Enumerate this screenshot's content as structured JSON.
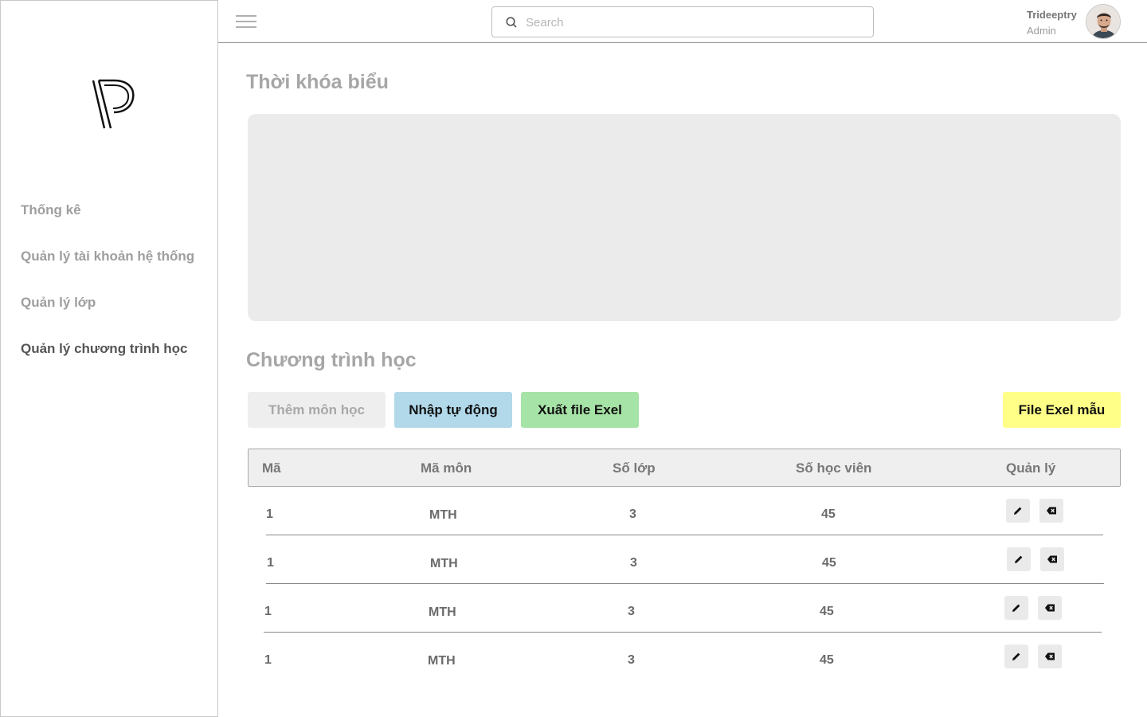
{
  "sidebar": {
    "logo_icon": "p-logo-icon",
    "items": [
      {
        "label": "Thống kê",
        "active": false
      },
      {
        "label": "Quản lý tài khoản hệ thống",
        "active": false
      },
      {
        "label": "Quản lý lớp",
        "active": false
      },
      {
        "label": "Quản lý chương trình học",
        "active": true
      }
    ]
  },
  "header": {
    "menu_icon": "hamburger-icon",
    "search": {
      "placeholder": "Search",
      "value": "",
      "icon": "search-icon"
    },
    "user": {
      "name": "Trideeptry",
      "role": "Admin",
      "avatar_icon": "avatar"
    }
  },
  "timetable": {
    "title": "Thời khóa biểu"
  },
  "program": {
    "title": "Chương trình học",
    "buttons": {
      "add": "Thêm môn học",
      "import": "Nhập tự động",
      "export": "Xuất file Exel",
      "template": "File Exel mẫu"
    },
    "colors": {
      "import": "#b1d9e9",
      "export": "#a6e3a6",
      "template": "#ffff88",
      "add": "#eeeeee"
    },
    "columns": [
      "Mã",
      "Mã môn",
      "Số lớp",
      "Số học viên",
      "Quản lý"
    ],
    "rows": [
      {
        "id": "1",
        "code": "MTH",
        "classes": "3",
        "students": "45"
      },
      {
        "id": "1",
        "code": "MTH",
        "classes": "3",
        "students": "45"
      },
      {
        "id": "1",
        "code": "MTH",
        "classes": "3",
        "students": "45"
      },
      {
        "id": "1",
        "code": "MTH",
        "classes": "3",
        "students": "45"
      }
    ],
    "row_actions": {
      "edit_icon": "pencil-icon",
      "delete_icon": "backspace-delete-icon"
    }
  }
}
